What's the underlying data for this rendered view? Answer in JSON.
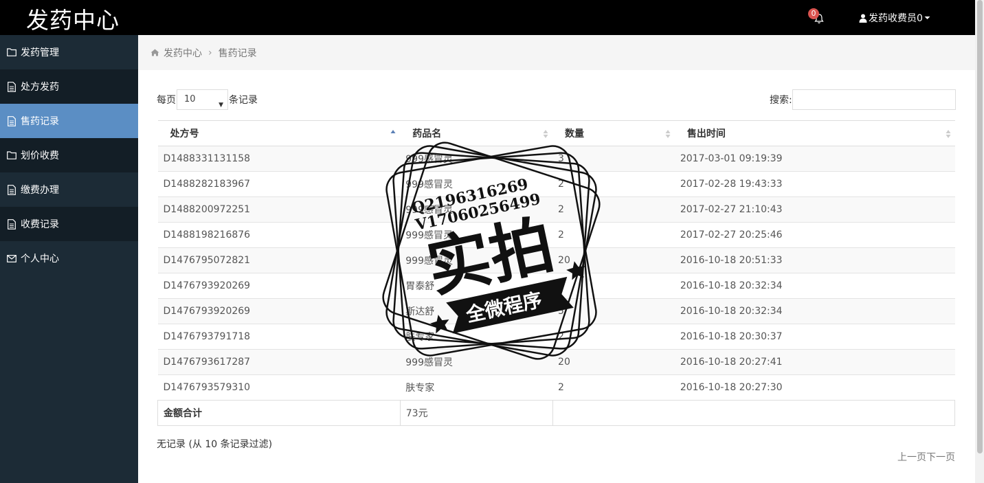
{
  "app": {
    "title": "发药中心"
  },
  "header": {
    "notification_count": "0",
    "user_label": "发药收费员0"
  },
  "sidebar": {
    "items": [
      {
        "label": "发药管理",
        "icon": "folder-icon"
      },
      {
        "label": "处方发药",
        "icon": "document-icon"
      },
      {
        "label": "售药记录",
        "icon": "document-icon"
      },
      {
        "label": "划价收费",
        "icon": "folder-icon"
      },
      {
        "label": "缴费办理",
        "icon": "document-icon"
      },
      {
        "label": "收费记录",
        "icon": "document-icon"
      },
      {
        "label": "个人中心",
        "icon": "envelope-icon"
      }
    ]
  },
  "breadcrumb": {
    "home": "发药中心",
    "current": "售药记录"
  },
  "table_controls": {
    "per_page_prefix": "每页",
    "per_page_value": "10",
    "per_page_suffix": "条记录",
    "search_label": "搜索:"
  },
  "table": {
    "columns": [
      "处方号",
      "药品名",
      "数量",
      "售出时间"
    ],
    "rows": [
      [
        "D1488331131158",
        "999感冒灵",
        "3",
        "2017-03-01 09:19:39"
      ],
      [
        "D1488282183967",
        "999感冒灵",
        "2",
        "2017-02-28 19:43:33"
      ],
      [
        "D1488200972251",
        "999感冒灵",
        "2",
        "2017-02-27 21:10:43"
      ],
      [
        "D1488198216876",
        "999感冒灵",
        "2",
        "2017-02-27 20:25:46"
      ],
      [
        "D1476795072821",
        "999感冒灵",
        "20",
        "2016-10-18 20:51:33"
      ],
      [
        "D1476793920269",
        "胃泰舒",
        "5",
        "2016-10-18 20:32:34"
      ],
      [
        "D1476793920269",
        "斯达舒",
        "5",
        "2016-10-18 20:32:34"
      ],
      [
        "D1476793791718",
        "肤专家",
        "2",
        "2016-10-18 20:30:37"
      ],
      [
        "D1476793617287",
        "999感冒灵",
        "20",
        "2016-10-18 20:27:41"
      ],
      [
        "D1476793579310",
        "肤专家",
        "2",
        "2016-10-18 20:27:30"
      ]
    ],
    "footer_label": "金额合计",
    "footer_value": "73元"
  },
  "table_info": "无记录 (从 10 条记录过滤)",
  "pagination": {
    "prev": "上一页",
    "next": "下一页"
  },
  "watermark": {
    "line1": "Q2196316269",
    "line2": "V17060256499",
    "main": "实拍",
    "banner": "全微程序"
  }
}
